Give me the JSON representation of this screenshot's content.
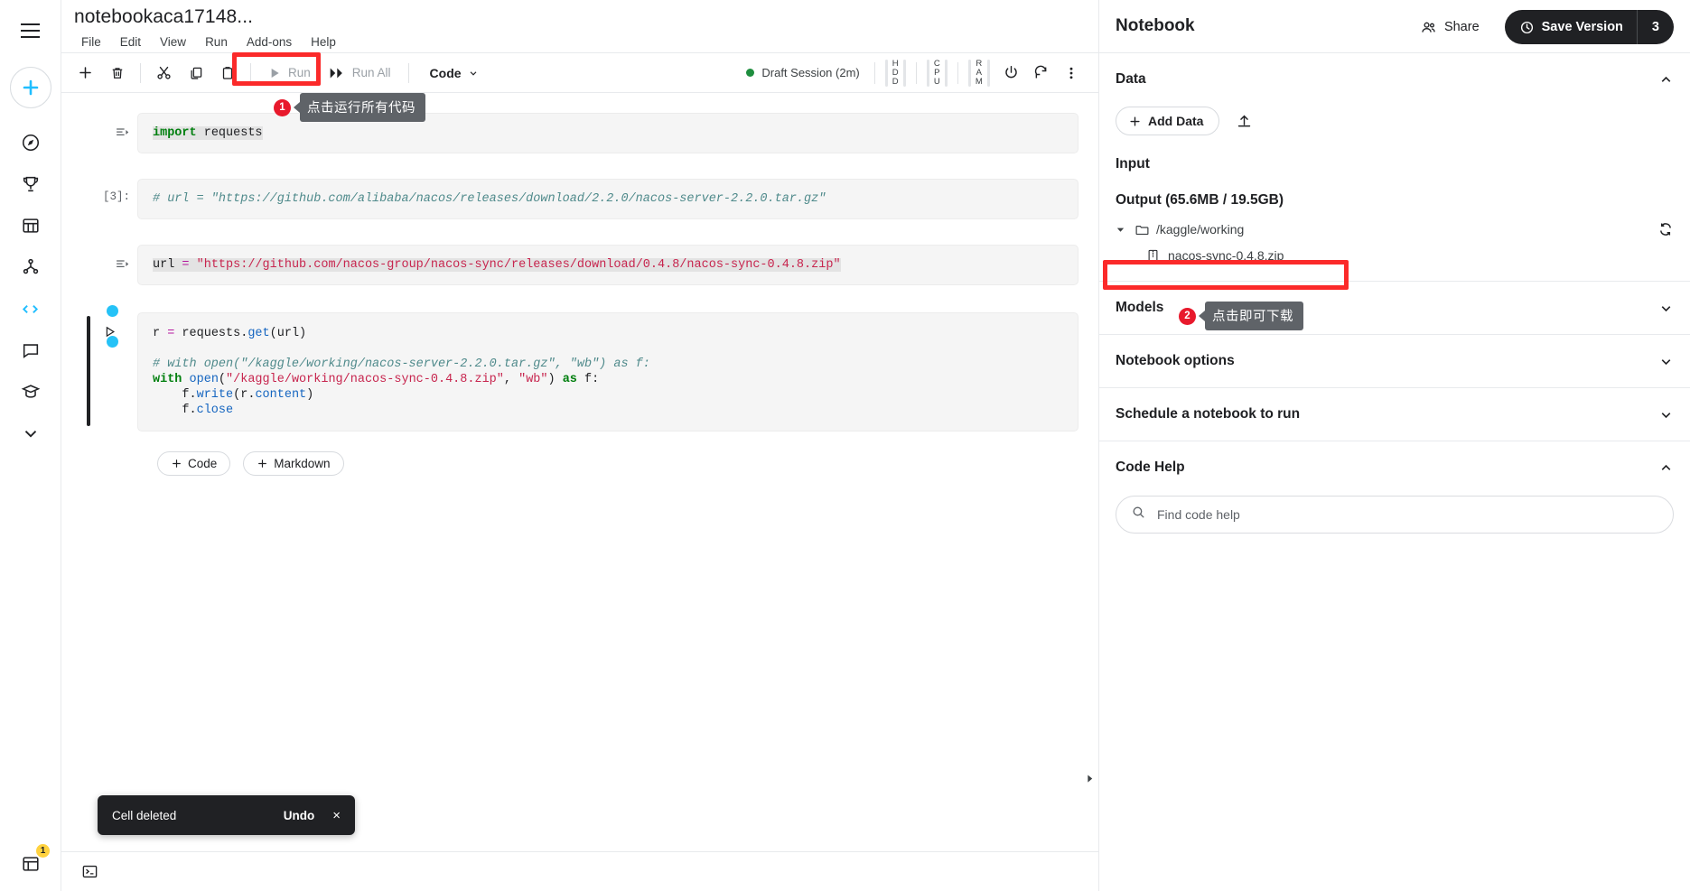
{
  "header": {
    "notebook_title": "notebookaca17148...",
    "menu": [
      "File",
      "Edit",
      "View",
      "Run",
      "Add-ons",
      "Help"
    ],
    "share_label": "Share",
    "save_version_label": "Save Version",
    "save_version_count": "3"
  },
  "toolbar": {
    "add_label": "add-cell",
    "delete_label": "delete-cell",
    "cut_label": "cut",
    "copy_label": "copy",
    "paste_label": "paste",
    "run_label": "Run",
    "run_all_label": "Run All",
    "cell_type": "Code",
    "session_status": "Draft Session (2m)",
    "cpu_label": "CPU",
    "ram_label": "RAM"
  },
  "annotations": [
    {
      "badge": "1",
      "text": "点击运行所有代码"
    },
    {
      "badge": "2",
      "text": "点击即可下载"
    }
  ],
  "cells": [
    {
      "exec": "",
      "lines": [
        [
          {
            "t": "import",
            "c": "k-kw sel-hl"
          },
          {
            "t": " ",
            "c": "sel-hl"
          },
          {
            "t": "requests",
            "c": "sel-hl"
          }
        ]
      ]
    },
    {
      "exec": "[3]:",
      "lines": [
        [
          {
            "t": "# url = \"https://github.com/alibaba/nacos/releases/download/2.2.0/nacos-server-2.2.0.tar.gz\"",
            "c": "k-cmt"
          }
        ]
      ]
    },
    {
      "exec": "",
      "lines": [
        [
          {
            "t": "url ",
            "c": "sel-hl"
          },
          {
            "t": "=",
            "c": "k-op sel-hl"
          },
          {
            "t": " ",
            "c": "sel-hl"
          },
          {
            "t": "\"https://github.com/nacos-group/nacos-sync/releases/download/0.4.8/nacos-sync-0.4.8.zip\"",
            "c": "k-str sel-hl"
          }
        ]
      ]
    },
    {
      "exec": "",
      "active": true,
      "lines": [
        [
          {
            "t": "r ",
            "c": ""
          },
          {
            "t": "=",
            "c": "k-op"
          },
          {
            "t": " requests.",
            "c": ""
          },
          {
            "t": "get",
            "c": "k-fn"
          },
          {
            "t": "(url)",
            "c": ""
          }
        ],
        [
          {
            "t": "",
            "c": ""
          }
        ],
        [
          {
            "t": "# with open(\"/kaggle/working/nacos-server-2.2.0.tar.gz\", \"wb\") as f:",
            "c": "k-cmt"
          }
        ],
        [
          {
            "t": "with",
            "c": "k-kw"
          },
          {
            "t": " ",
            "c": ""
          },
          {
            "t": "open",
            "c": "k-fn"
          },
          {
            "t": "(",
            "c": ""
          },
          {
            "t": "\"/kaggle/working/nacos-sync-0.4.8.zip\"",
            "c": "k-str"
          },
          {
            "t": ", ",
            "c": ""
          },
          {
            "t": "\"wb\"",
            "c": "k-str"
          },
          {
            "t": ") ",
            "c": ""
          },
          {
            "t": "as",
            "c": "k-kw"
          },
          {
            "t": " f:",
            "c": ""
          }
        ],
        [
          {
            "t": "    f.",
            "c": ""
          },
          {
            "t": "write",
            "c": "k-attr"
          },
          {
            "t": "(r.",
            "c": ""
          },
          {
            "t": "content",
            "c": "k-attr"
          },
          {
            "t": ")",
            "c": ""
          }
        ],
        [
          {
            "t": "    f.",
            "c": ""
          },
          {
            "t": "close",
            "c": "k-attr"
          }
        ]
      ]
    }
  ],
  "add_cell": {
    "code_label": "Code",
    "markdown_label": "Markdown"
  },
  "toast": {
    "message": "Cell deleted",
    "undo_label": "Undo",
    "close_label": "×"
  },
  "right_panel": {
    "title": "Notebook",
    "data_section": {
      "title": "Data",
      "add_data_label": "Add Data",
      "input_label": "Input",
      "output_label": "Output (65.6MB / 19.5GB)",
      "folder": "/kaggle/working",
      "file": "nacos-sync-0.4.8.zip"
    },
    "sections": [
      {
        "title": "Models",
        "expanded": false
      },
      {
        "title": "Notebook options",
        "expanded": false
      },
      {
        "title": "Schedule a notebook to run",
        "expanded": false
      },
      {
        "title": "Code Help",
        "expanded": true
      }
    ],
    "code_help": {
      "placeholder": "Find code help"
    }
  },
  "left_rail": {
    "notification_count": "1"
  },
  "colors": {
    "annotation_red": "#fb2a2a",
    "badge_red": "#e8192c",
    "accent_cyan": "#20beff",
    "session_green": "#1e8e3e"
  }
}
